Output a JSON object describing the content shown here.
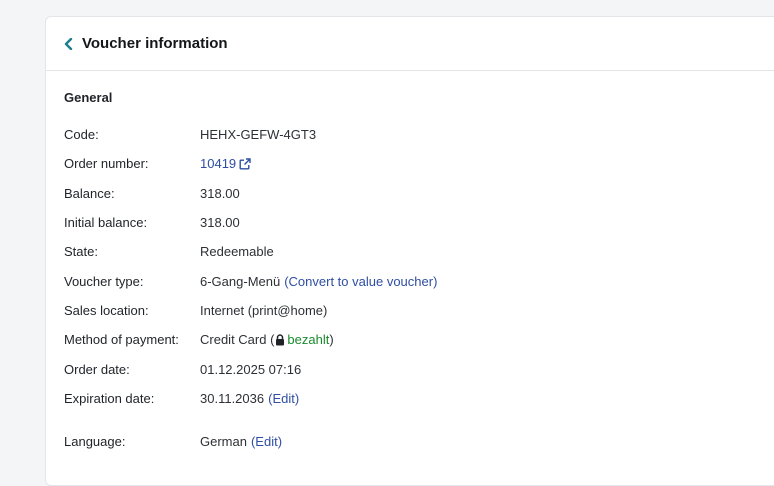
{
  "header": {
    "title": "Voucher information",
    "back_icon": "chevron-left-icon"
  },
  "colors": {
    "link": "#2f4ea4",
    "accent_chevron": "#1d7f8c",
    "paid": "#1a8a2e"
  },
  "general": {
    "title": "General",
    "code": {
      "label": "Code:",
      "value": "HEHX-GEFW-4GT3"
    },
    "order_number": {
      "label": "Order number:",
      "value": "10419",
      "icon": "external-link-icon"
    },
    "balance": {
      "label": "Balance:",
      "value": "318.00"
    },
    "initial_balance": {
      "label": "Initial balance:",
      "value": "318.00"
    },
    "state": {
      "label": "State:",
      "value": "Redeemable"
    },
    "voucher_type": {
      "label": "Voucher type:",
      "value": "6-Gang-Menü",
      "action": "(Convert to value voucher)"
    },
    "sales_location": {
      "label": "Sales location:",
      "value": "Internet (print@home)"
    },
    "payment": {
      "label": "Method of payment:",
      "value": "Credit Card (",
      "status": "bezahlt",
      "close": ")",
      "icon": "lock-icon"
    },
    "order_date": {
      "label": "Order date:",
      "value": "01.12.2025 07:16"
    },
    "expiration_date": {
      "label": "Expiration date:",
      "value": "30.11.2036",
      "action": "(Edit)"
    },
    "language": {
      "label": "Language:",
      "value": "German",
      "action": "(Edit)"
    }
  }
}
